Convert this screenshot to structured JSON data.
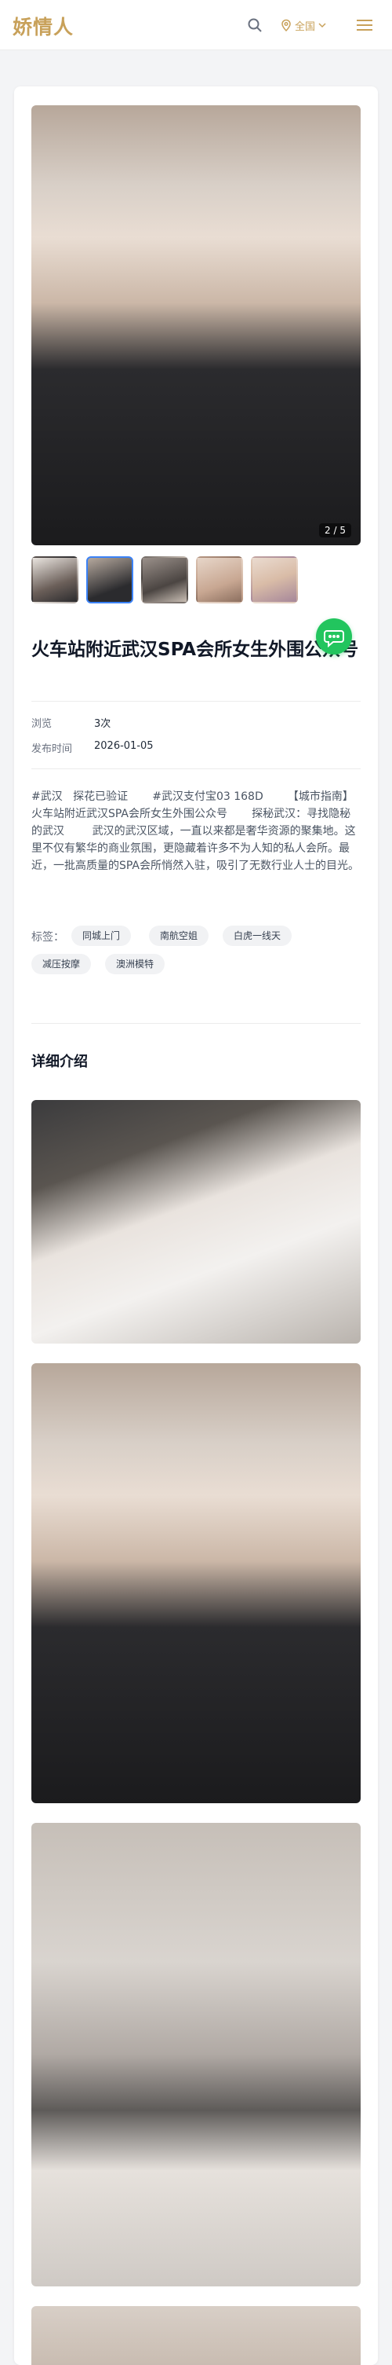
{
  "header": {
    "logo": "娇情人",
    "region_label": "全国",
    "icons": {
      "search": "search-icon",
      "region": "location-pin-icon",
      "region_caret": "chevron-down-icon",
      "menu": "hamburger-menu-icon"
    },
    "accent_color": "#c8a15a"
  },
  "gallery": {
    "counter": "2 / 5",
    "thumb_count": 5,
    "active_thumb": 2
  },
  "post": {
    "title": "火车站附近武汉SPA会所女生外围公众号",
    "meta": [
      {
        "label": "浏览",
        "value": "3次"
      },
      {
        "label": "发布时间",
        "value": "2026-01-05"
      }
    ],
    "description": "#武汉   探花已验证       #武汉支付宝03 168D       【城市指南】火车站附近武汉SPA会所女生外围公众号       探秘武汉：寻找隐秘的武汉        武汉的武汉区域，一直以来都是奢华资源的聚集地。这里不仅有繁华的商业氛围，更隐藏着许多不为人知的私人会所。最近，一批高质量的SPA会所悄然入驻，吸引了无数行业人士的目光。        女生的独特魅力在哪里        提到这批新资源，不得不提的就是女生。她",
    "tags_label": "标签：",
    "tags": [
      "同城上门",
      "南航空姐",
      "白虎一线天",
      "减压按摩",
      "澳洲模特"
    ]
  },
  "chat": {
    "icon": "chat-bubble-icon",
    "color": "#22c55e"
  },
  "details": {
    "title": "详细介绍"
  }
}
